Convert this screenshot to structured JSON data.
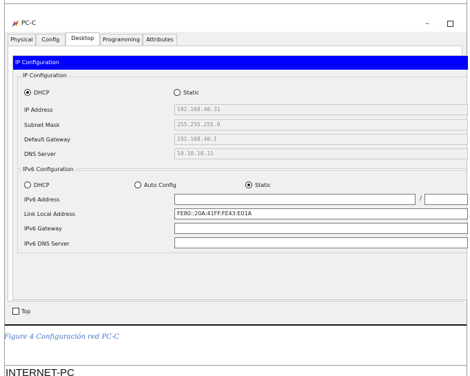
{
  "window": {
    "title": "PC-C",
    "minimize_glyph": "–"
  },
  "tabs": [
    {
      "label": "Physical",
      "active": false
    },
    {
      "label": "Config",
      "active": false
    },
    {
      "label": "Desktop",
      "active": true
    },
    {
      "label": "Programming",
      "active": false
    },
    {
      "label": "Attributes",
      "active": false
    }
  ],
  "ip_config": {
    "header": "IP Configuration",
    "group_label": "IP Configuration",
    "mode_dhcp": "DHCP",
    "mode_static": "Static",
    "selected_mode": "DHCP",
    "fields": [
      {
        "label": "IP Address",
        "value": "192.168.40.31"
      },
      {
        "label": "Subnet Mask",
        "value": "255.255.255.0"
      },
      {
        "label": "Default Gateway",
        "value": "192.168.40.1"
      },
      {
        "label": "DNS Server",
        "value": "10.10.10.11"
      }
    ]
  },
  "ipv6_config": {
    "group_label": "IPv6 Configuration",
    "mode_dhcp": "DHCP",
    "mode_auto": "Auto Config",
    "mode_static": "Static",
    "selected_mode": "Static",
    "prefix_separator": "/",
    "fields": [
      {
        "label": "IPv6 Address",
        "value": ""
      },
      {
        "label": "Link Local Address",
        "value": "FE80::20A:41FF:FE43:E01A"
      },
      {
        "label": "IPv6 Gateway",
        "value": ""
      },
      {
        "label": "IPv6 DNS Server",
        "value": ""
      }
    ]
  },
  "footer": {
    "top_checkbox_label": "Top",
    "top_checked": false
  },
  "document": {
    "caption": "Figure 4 Configuración red PC-C",
    "next_heading": "INTERNET-PC"
  },
  "colors": {
    "header_blue": "#0000ff",
    "caption_blue": "#4472c4",
    "window_bg": "#f0f0f0"
  }
}
